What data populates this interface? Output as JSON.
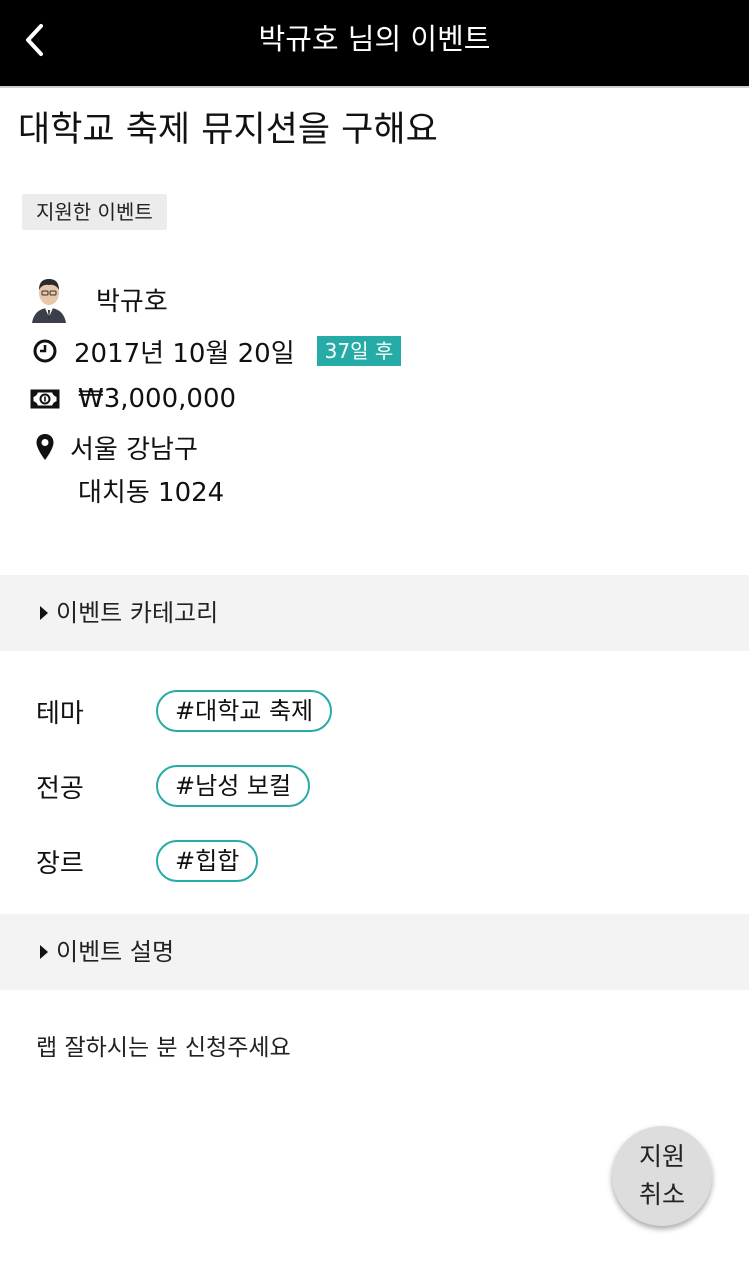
{
  "header": {
    "title": "박규호 님의 이벤트",
    "back_icon": "chevron-left-icon"
  },
  "event": {
    "title": "대학교 축제 뮤지션을 구해요",
    "status_badge": "지원한 이벤트",
    "host_name": "박규호",
    "date": "2017년 10월 20일",
    "dday": "37일 후",
    "price": "₩3,000,000",
    "location_line1": "서울 강남구",
    "location_line2": "대치동 1024"
  },
  "icons": {
    "clock": "clock-icon",
    "money": "money-icon",
    "location": "map-pin-icon"
  },
  "category": {
    "header": "이벤트 카테고리",
    "rows": [
      {
        "label": "테마",
        "tag": "#대학교 축제"
      },
      {
        "label": "전공",
        "tag": "#남성 보컬"
      },
      {
        "label": "장르",
        "tag": "#힙합"
      }
    ]
  },
  "description": {
    "header": "이벤트 설명",
    "text": "랩 잘하시는 분 신청주세요"
  },
  "fab": {
    "line1": "지원",
    "line2": "취소"
  },
  "colors": {
    "accent": "#26aba6",
    "topbar": "#000000",
    "section_bg": "#f3f3f3"
  }
}
